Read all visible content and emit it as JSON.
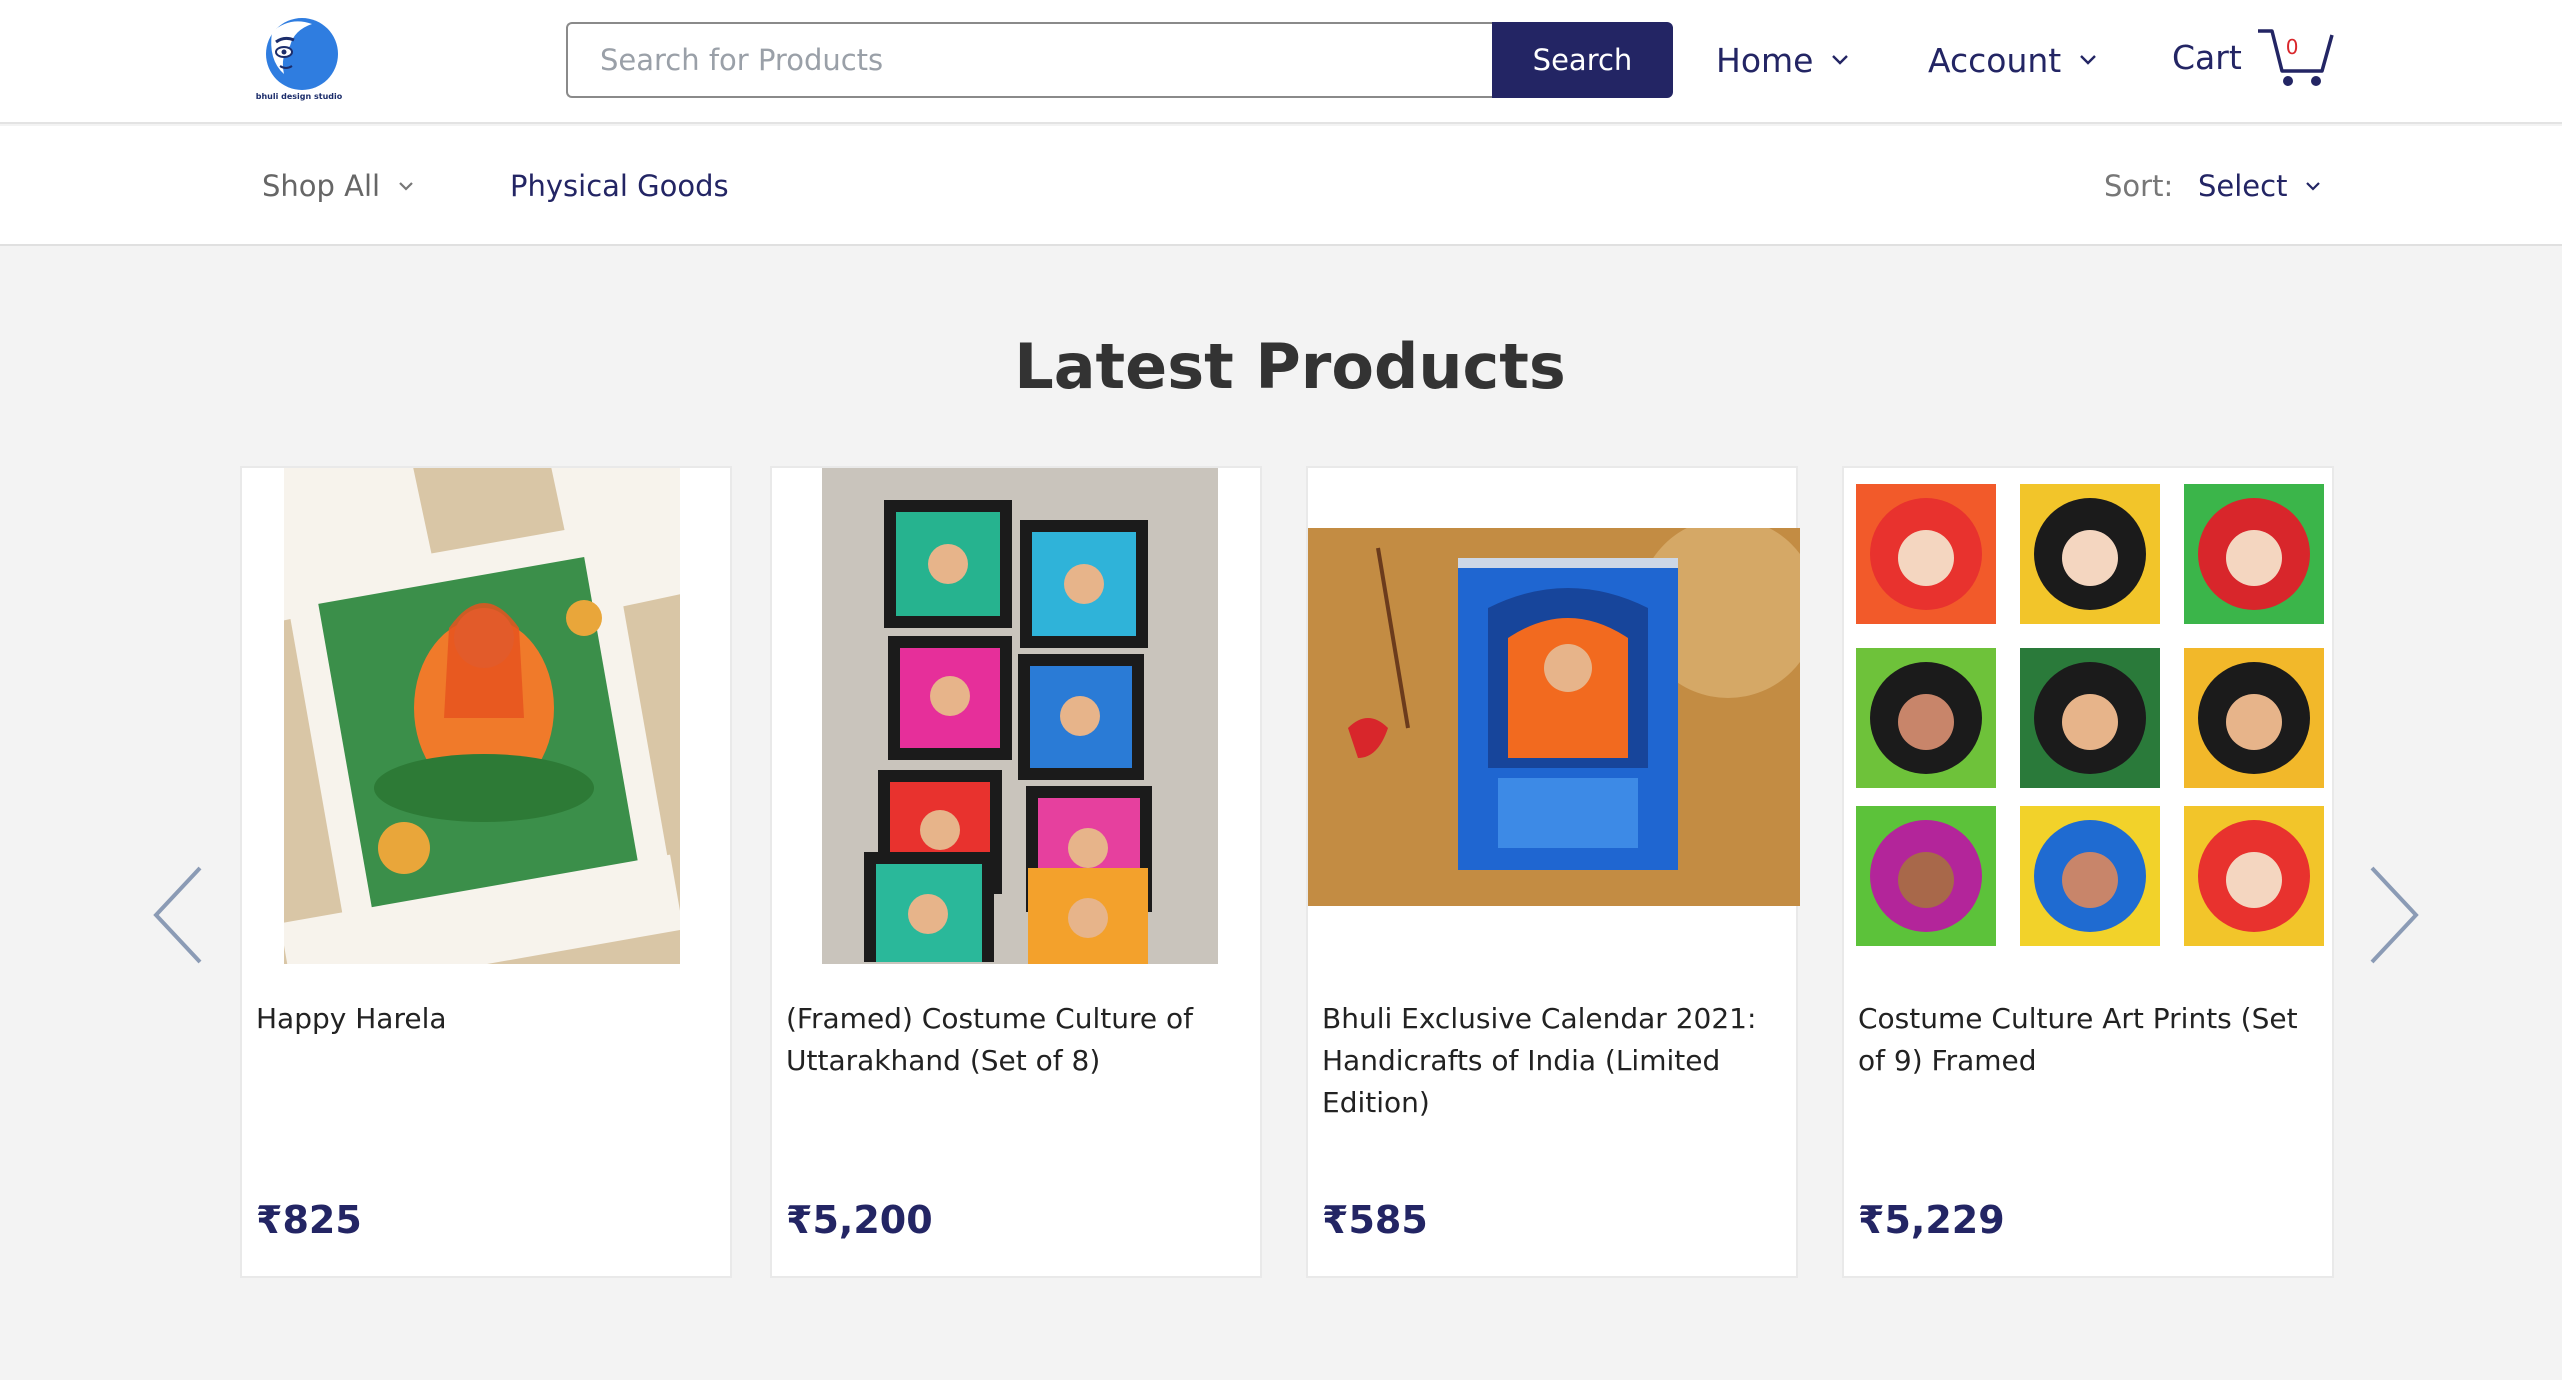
{
  "header": {
    "logo_text": "bhuli design studio",
    "search": {
      "placeholder": "Search for Products",
      "value": ""
    },
    "search_button": "Search",
    "nav": [
      {
        "label": "Home"
      },
      {
        "label": "Account"
      }
    ],
    "cart": {
      "label": "Cart",
      "count": "0"
    }
  },
  "subnav": {
    "shop_all": "Shop All",
    "category": "Physical Goods",
    "sort_label": "Sort:",
    "sort_value": "Select"
  },
  "main": {
    "heading": "Latest Products",
    "products": [
      {
        "title": "Happy Harela",
        "price": "₹825"
      },
      {
        "title": "(Framed) Costume Culture of Uttarakhand (Set of 8)",
        "price": "₹5,200"
      },
      {
        "title": "Bhuli Exclusive Calendar 2021: Handicrafts of India (Limited Edition)",
        "price": "₹585"
      },
      {
        "title": "Costume Culture Art Prints (Set of 9) Framed",
        "price": "₹5,229"
      }
    ]
  },
  "colors": {
    "brand": "#232564",
    "accent_red": "#d9262b",
    "page_bg": "#f3f3f3"
  },
  "icons": [
    "logo-face-icon",
    "chevron-down-icon",
    "cart-icon",
    "arrow-left-icon",
    "arrow-right-icon"
  ]
}
